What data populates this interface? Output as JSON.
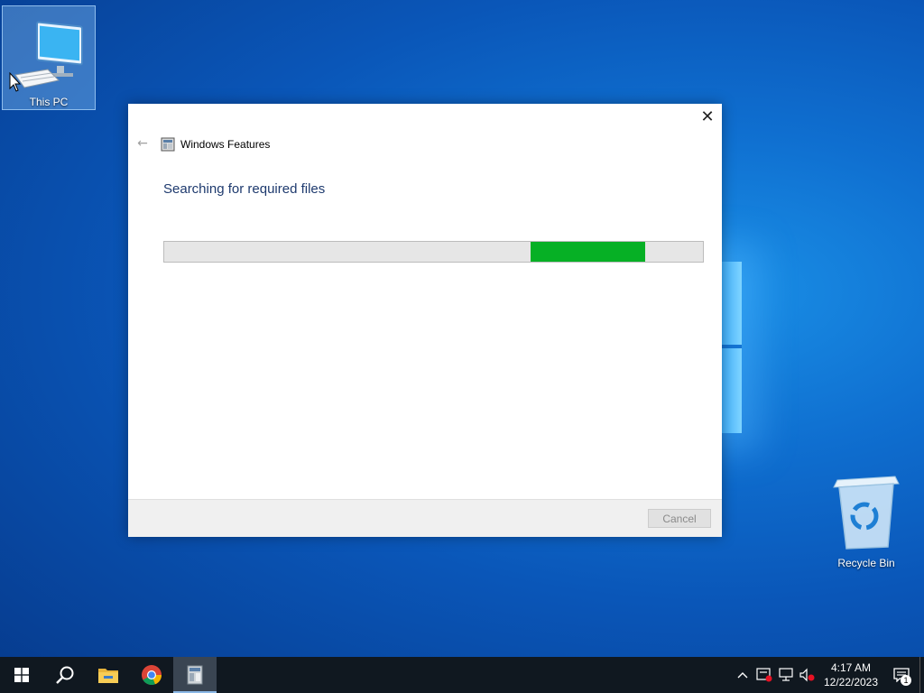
{
  "desktop": {
    "icons": [
      {
        "label": "This PC",
        "icon": "computer-icon"
      },
      {
        "label": "Recycle Bin",
        "icon": "recycle-bin-icon"
      }
    ]
  },
  "dialog": {
    "title": "Windows Features",
    "heading": "Searching for required files",
    "progress": {
      "style": "marquee",
      "color": "#06b025"
    },
    "cancel_label": "Cancel",
    "close_glyph": "✕",
    "back_glyph": "←"
  },
  "taskbar": {
    "apps": [
      {
        "name": "Start",
        "icon": "windows-start-icon"
      },
      {
        "name": "Search",
        "icon": "search-icon"
      },
      {
        "name": "File Explorer",
        "icon": "folder-icon"
      },
      {
        "name": "Google Chrome",
        "icon": "chrome-icon"
      },
      {
        "name": "Windows Features",
        "icon": "windows-features-icon",
        "active": true
      }
    ],
    "tray": {
      "chevron": "^",
      "time": "4:17 AM",
      "date": "12/22/2023",
      "notification_count": "1"
    }
  },
  "colors": {
    "accent_green": "#06b025",
    "heading_blue": "#1e3a6e",
    "taskbar": "#101820"
  }
}
